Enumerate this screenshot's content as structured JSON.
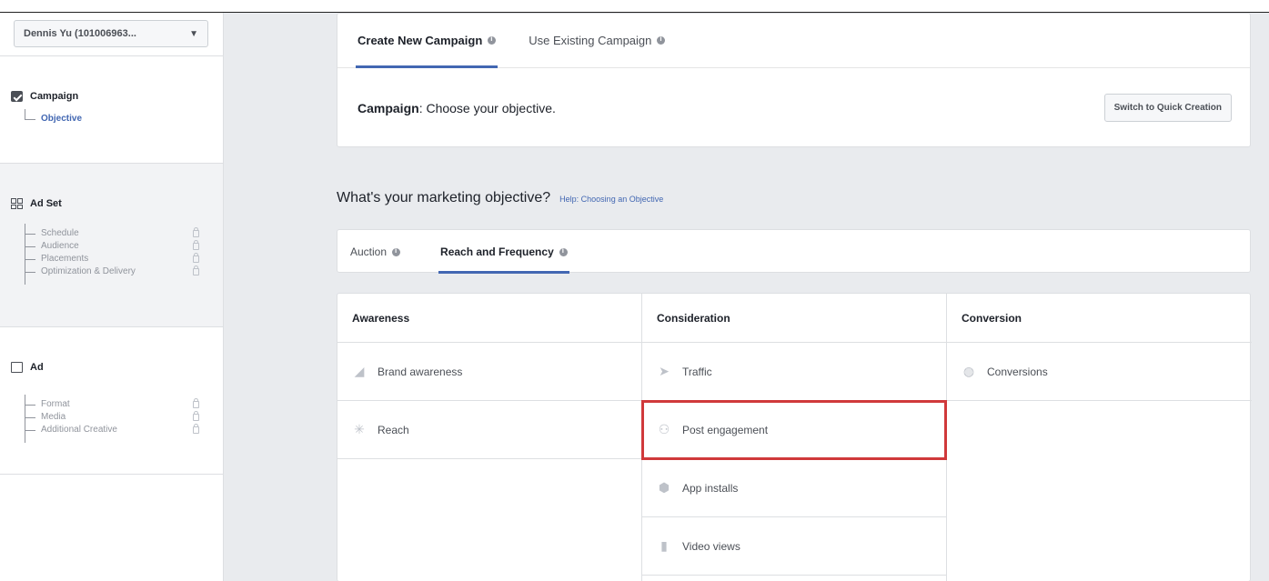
{
  "account": {
    "name": "Dennis Yu (101006963..."
  },
  "sidebar": {
    "campaign": {
      "title": "Campaign",
      "items": [
        {
          "label": "Objective"
        }
      ]
    },
    "adset": {
      "title": "Ad Set",
      "items": [
        {
          "label": "Schedule"
        },
        {
          "label": "Audience"
        },
        {
          "label": "Placements"
        },
        {
          "label": "Optimization & Delivery"
        }
      ]
    },
    "ad": {
      "title": "Ad",
      "items": [
        {
          "label": "Format"
        },
        {
          "label": "Media"
        },
        {
          "label": "Additional Creative"
        }
      ]
    }
  },
  "main": {
    "tabs": [
      {
        "label": "Create New Campaign",
        "active": true
      },
      {
        "label": "Use Existing Campaign",
        "active": false
      }
    ],
    "campaign_label": "Campaign",
    "campaign_text": ": Choose your objective.",
    "quick_button": "Switch to Quick Creation",
    "question": "What's your marketing objective?",
    "help_link": "Help: Choosing an Objective",
    "buying_tabs": [
      {
        "label": "Auction",
        "active": false
      },
      {
        "label": "Reach and Frequency",
        "active": true
      }
    ],
    "columns": [
      {
        "title": "Awareness",
        "items": [
          {
            "label": "Brand awareness",
            "icon": "megaphone-icon"
          },
          {
            "label": "Reach",
            "icon": "reach-icon"
          }
        ]
      },
      {
        "title": "Consideration",
        "items": [
          {
            "label": "Traffic",
            "icon": "cursor-icon"
          },
          {
            "label": "Post engagement",
            "icon": "people-icon",
            "highlighted": true
          },
          {
            "label": "App installs",
            "icon": "box-icon"
          },
          {
            "label": "Video views",
            "icon": "video-icon"
          }
        ]
      },
      {
        "title": "Conversion",
        "items": [
          {
            "label": "Conversions",
            "icon": "globe-icon"
          }
        ]
      }
    ]
  },
  "colors": {
    "accent": "#4267b2",
    "highlight": "#d0393b",
    "background": "#e9ebee"
  }
}
